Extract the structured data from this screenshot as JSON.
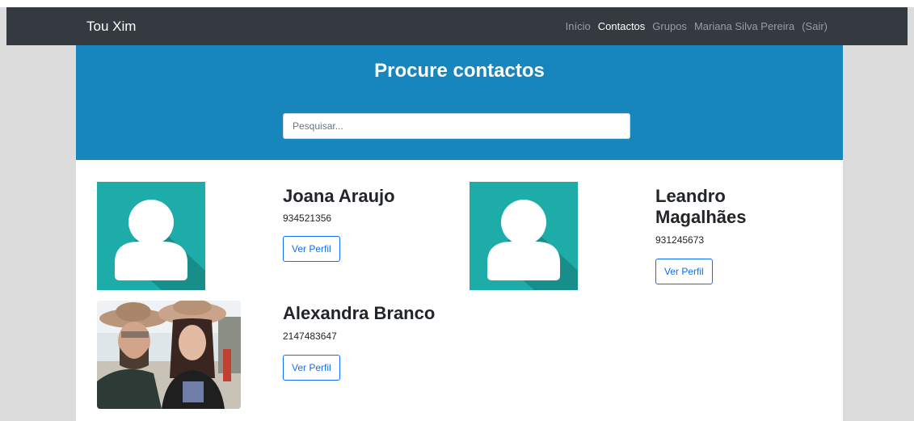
{
  "navbar": {
    "brand": "Tou Xim",
    "links": [
      "Início",
      "Contactos",
      "Grupos"
    ],
    "user_name": "Mariana Silva Pereira",
    "logout": "(Sair)"
  },
  "hero": {
    "title": "Procure contactos",
    "search_placeholder": "Pesquisar..."
  },
  "contacts": [
    {
      "name": "Joana Araujo",
      "phone": "934521356",
      "button": "Ver Perfil",
      "image": "default-avatar-icon"
    },
    {
      "name": "Leandro Magalhães",
      "phone": "931245673",
      "button": "Ver Perfil",
      "image": "default-avatar-icon"
    },
    {
      "name": "Alexandra Branco",
      "phone": "2147483647",
      "button": "Ver Perfil",
      "image": "profile-photo"
    }
  ],
  "colors": {
    "navbar_bg": "#353a40",
    "hero_bg": "#1686bc",
    "avatar_bg": "#1eaca8",
    "button_accent": "#0d6efd"
  }
}
